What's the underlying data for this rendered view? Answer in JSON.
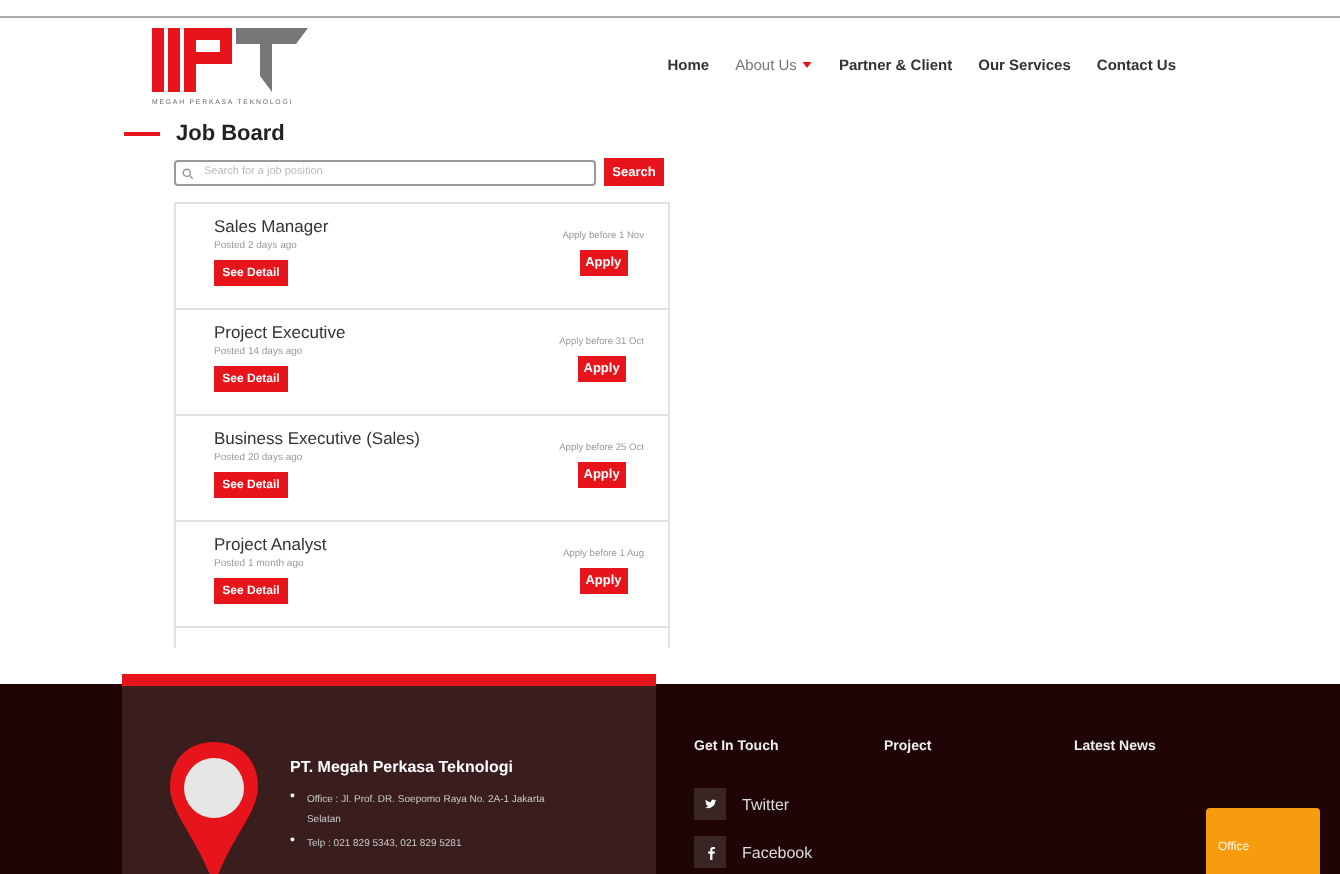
{
  "logo": {
    "tagline": "MEGAH PERKASA TEKNOLOGI"
  },
  "nav": [
    {
      "label": "Home",
      "kind": "link"
    },
    {
      "label": "About Us",
      "kind": "dropdown"
    },
    {
      "label": "Partner & Client",
      "kind": "link"
    },
    {
      "label": "Our Services",
      "kind": "link"
    },
    {
      "label": "Contact Us",
      "kind": "link"
    }
  ],
  "page_title": "Job Board",
  "search": {
    "placeholder": "Search for a job position",
    "button": "Search"
  },
  "jobs": [
    {
      "title": "Sales Manager",
      "posted": "Posted 2 days ago",
      "deadline": "Apply before 1 Nov",
      "detail_button": "See Detail",
      "apply_button": "Apply"
    },
    {
      "title": "Project Executive",
      "posted": "Posted 14 days ago",
      "deadline": "Apply before 31 Oct",
      "detail_button": "See Detail",
      "apply_button": "Apply"
    },
    {
      "title": "Business Executive (Sales)",
      "posted": "Posted 20 days ago",
      "deadline": "Apply before 25 Oct",
      "detail_button": "See Detail",
      "apply_button": "Apply"
    },
    {
      "title": "Project Analyst",
      "posted": "Posted 1 month ago",
      "deadline": "Apply before 1 Aug",
      "detail_button": "See Detail",
      "apply_button": "Apply"
    }
  ],
  "footer": {
    "company": "PT. Megah Perkasa Teknologi",
    "address_lines": [
      {
        "bullet": "•",
        "text": "Office : Jl. Prof. DR. Soepomo Raya No. 2A-1 Jakarta Selatan"
      },
      {
        "bullet": "•",
        "text": "Telp : 021 829 5343, 021 829 5281"
      }
    ],
    "columns": [
      {
        "heading": "Get In Touch"
      },
      {
        "heading": "Project"
      },
      {
        "heading": "Latest News"
      }
    ],
    "social": [
      {
        "label": "Twitter",
        "kind": "twitter"
      },
      {
        "label": "Facebook",
        "kind": "facebook"
      }
    ],
    "chat": {
      "label": "Office"
    }
  }
}
